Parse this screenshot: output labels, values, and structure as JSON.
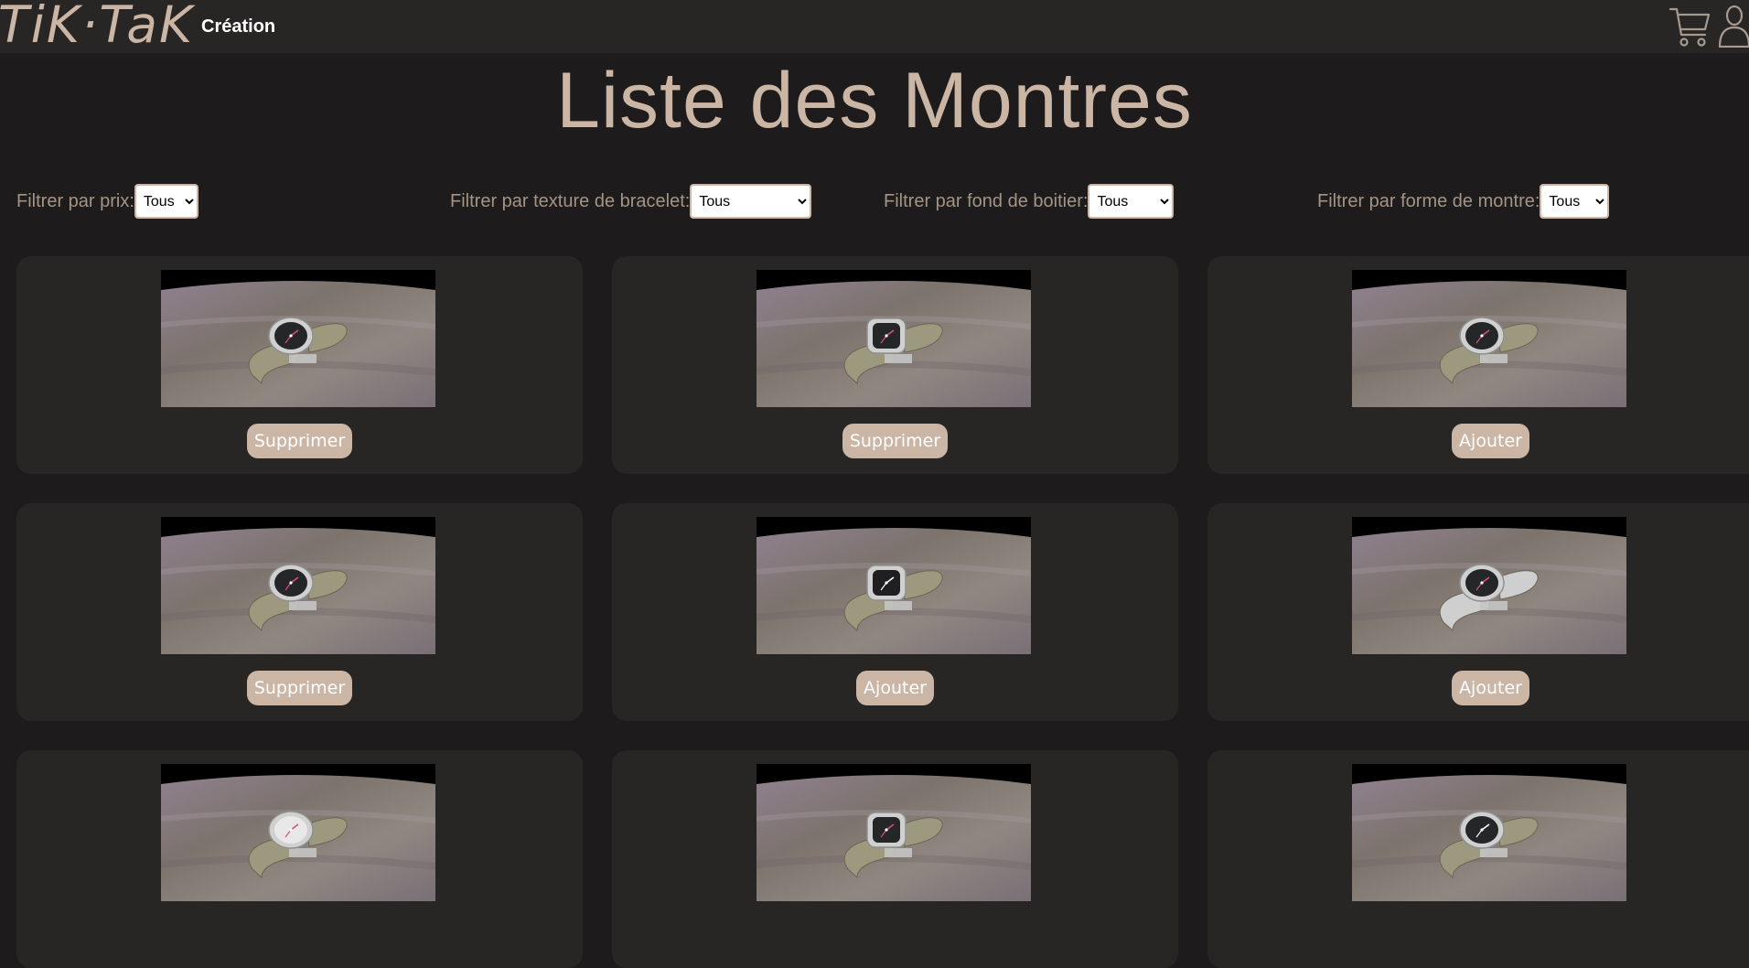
{
  "header": {
    "logo": "TiK·TaK",
    "nav_label": "Création",
    "cart_icon": "cart-icon",
    "user_icon": "user-icon"
  },
  "title": "Liste des Montres",
  "filters": [
    {
      "label": "Filtrer par prix:",
      "selected": "Tous"
    },
    {
      "label": "Filtrer par texture de bracelet:",
      "selected": "Tous"
    },
    {
      "label": "Filtrer par fond de boitier:",
      "selected": "Tous"
    },
    {
      "label": "Filtrer par forme de montre:",
      "selected": "Tous"
    }
  ],
  "colors": {
    "background": "#1d1b1b",
    "panel": "#282525",
    "accent": "#cbb6a6",
    "filter_text": "#a49486"
  },
  "watches": [
    {
      "button": "Supprimer",
      "face": "#252628",
      "case": "round",
      "strap": "#9d997f",
      "hands": "#d64f7a"
    },
    {
      "button": "Supprimer",
      "face": "#252628",
      "case": "square",
      "strap": "#9d997f",
      "hands": "#d64f7a"
    },
    {
      "button": "Ajouter",
      "face": "#252628",
      "case": "round",
      "strap": "#9d997f",
      "hands": "#d64f7a"
    },
    {
      "button": "Supprimer",
      "face": "#252628",
      "case": "round",
      "strap": "#9d997f",
      "hands": "#d64f7a"
    },
    {
      "button": "Ajouter",
      "face": "#1f1f21",
      "case": "square",
      "strap": "#9d997f",
      "hands": "#ffffff"
    },
    {
      "button": "Ajouter",
      "face": "#252628",
      "case": "round",
      "strap": "#cfcfcf",
      "hands": "#d64f7a"
    },
    {
      "button": "",
      "face": "#e8e8e8",
      "case": "round",
      "strap": "#9d997f",
      "hands": "#d64f7a"
    },
    {
      "button": "",
      "face": "#252628",
      "case": "square",
      "strap": "#9d997f",
      "hands": "#d64f7a"
    },
    {
      "button": "",
      "face": "#252628",
      "case": "round",
      "strap": "#9d997f",
      "hands": "#ffffff"
    }
  ]
}
